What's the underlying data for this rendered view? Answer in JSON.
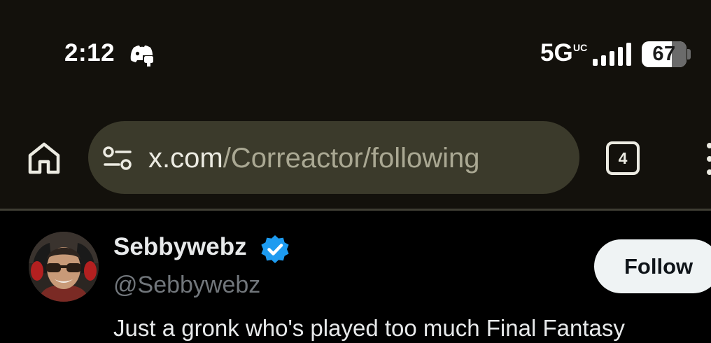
{
  "status_bar": {
    "time": "2:12",
    "notification_icon": "discord-icon",
    "network": "5G",
    "network_suffix": "UC",
    "signal_icon": "signal-bars-icon",
    "battery_level": "67"
  },
  "browser": {
    "home_icon": "home-icon",
    "site_settings_icon": "tune-icon",
    "url_domain": "x.com",
    "url_path": "/Correactor/following",
    "tab_count": "4",
    "menu_icon": "more-vertical-icon"
  },
  "user": {
    "display_name": "Sebbywebz",
    "verified": true,
    "verified_icon": "verified-badge-icon",
    "handle": "@Sebbywebz",
    "follow_label": "Follow",
    "bio": "Just a gronk who's played too much Final Fantasy"
  },
  "colors": {
    "chrome_background": "#13110c",
    "url_bar_background": "#3b3a2b",
    "page_background": "#000000",
    "verified_blue": "#1d9bf0",
    "follow_button": "#eff3f4",
    "handle_gray": "#71767b"
  }
}
